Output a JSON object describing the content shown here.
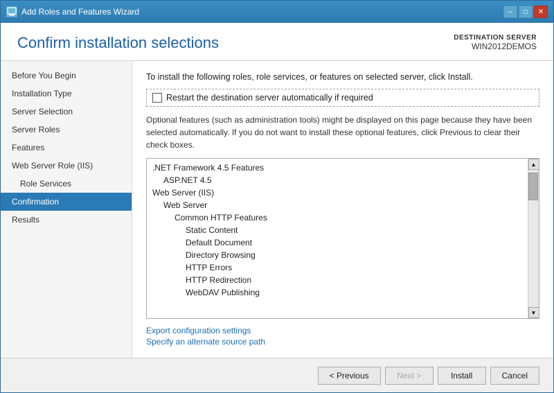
{
  "window": {
    "title": "Add Roles and Features Wizard",
    "icon_char": "🖥"
  },
  "title_bar_controls": {
    "minimize": "–",
    "maximize": "□",
    "close": "✕"
  },
  "header": {
    "title": "Confirm installation selections",
    "dest_server_label": "DESTINATION SERVER",
    "dest_server_name": "WIN2012DEMOS"
  },
  "sidebar": {
    "items": [
      {
        "id": "before-you-begin",
        "label": "Before You Begin",
        "indent": 0,
        "active": false
      },
      {
        "id": "installation-type",
        "label": "Installation Type",
        "indent": 0,
        "active": false
      },
      {
        "id": "server-selection",
        "label": "Server Selection",
        "indent": 0,
        "active": false
      },
      {
        "id": "server-roles",
        "label": "Server Roles",
        "indent": 0,
        "active": false
      },
      {
        "id": "features",
        "label": "Features",
        "indent": 0,
        "active": false
      },
      {
        "id": "web-server-role",
        "label": "Web Server Role (IIS)",
        "indent": 0,
        "active": false
      },
      {
        "id": "role-services",
        "label": "Role Services",
        "indent": 1,
        "active": false
      },
      {
        "id": "confirmation",
        "label": "Confirmation",
        "indent": 0,
        "active": true
      },
      {
        "id": "results",
        "label": "Results",
        "indent": 0,
        "active": false
      }
    ]
  },
  "main": {
    "instruction": "To install the following roles, role services, or features on selected server, click Install.",
    "checkbox_label": "Restart the destination server automatically if required",
    "checkbox_checked": false,
    "optional_text": "Optional features (such as administration tools) might be displayed on this page because they have been selected automatically. If you do not want to install these optional features, click Previous to clear their check boxes.",
    "features": [
      {
        "label": ".NET Framework 4.5 Features",
        "level": 1
      },
      {
        "label": "ASP.NET 4.5",
        "level": 2
      },
      {
        "label": "Web Server (IIS)",
        "level": 1
      },
      {
        "label": "Web Server",
        "level": 2
      },
      {
        "label": "Common HTTP Features",
        "level": 3
      },
      {
        "label": "Static Content",
        "level": 4
      },
      {
        "label": "Default Document",
        "level": 4
      },
      {
        "label": "Directory Browsing",
        "level": 4
      },
      {
        "label": "HTTP Errors",
        "level": 4
      },
      {
        "label": "HTTP Redirection",
        "level": 4
      },
      {
        "label": "WebDAV Publishing",
        "level": 4
      }
    ],
    "links": [
      {
        "id": "export-config",
        "label": "Export configuration settings"
      },
      {
        "id": "alt-source",
        "label": "Specify an alternate source path"
      }
    ]
  },
  "footer": {
    "previous_label": "< Previous",
    "next_label": "Next >",
    "install_label": "Install",
    "cancel_label": "Cancel"
  }
}
